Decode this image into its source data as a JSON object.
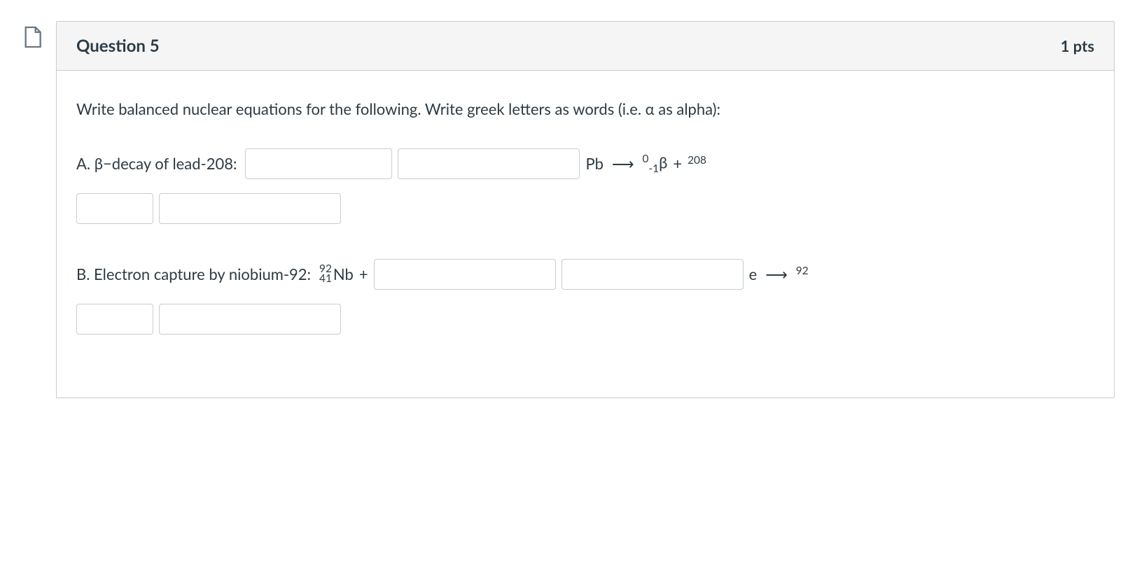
{
  "header": {
    "title": "Question 5",
    "points": "1 pts"
  },
  "instruction": "Write balanced nuclear equations for the following. Write greek letters as words (i.e. α as alpha):",
  "partA": {
    "label": "A. β−decay of lead-208:",
    "symbol": "Pb",
    "arrow": "⟶",
    "beta_sup": "0",
    "beta_sub": "-1",
    "beta_sym": "β",
    "plus": "+",
    "product_mass": "208"
  },
  "partB": {
    "label": "B. Electron capture by niobium-92:",
    "nb_mass": "92",
    "nb_atomic": "41",
    "nb_sym": "Nb",
    "plus1": "+",
    "e_sym": "e",
    "arrow": "⟶",
    "product_mass": "92"
  }
}
